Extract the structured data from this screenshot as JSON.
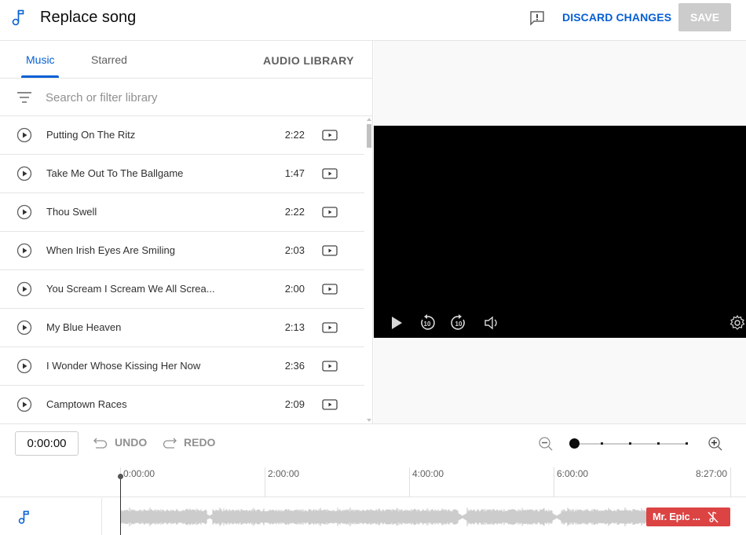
{
  "header": {
    "title": "Replace song",
    "discard_label": "DISCARD CHANGES",
    "save_label": "SAVE",
    "icons": {
      "app": "music-note-icon",
      "feedback": "feedback-icon"
    }
  },
  "library": {
    "tabs": [
      {
        "label": "Music",
        "active": true
      },
      {
        "label": "Starred",
        "active": false
      }
    ],
    "audio_library_label": "AUDIO LIBRARY",
    "search": {
      "placeholder": "Search or filter library",
      "value": ""
    },
    "tracks": [
      {
        "title": "Putting On The Ritz",
        "duration": "2:22"
      },
      {
        "title": "Take Me Out To The Ballgame",
        "duration": "1:47"
      },
      {
        "title": "Thou Swell",
        "duration": "2:22"
      },
      {
        "title": "When Irish Eyes Are Smiling",
        "duration": "2:03"
      },
      {
        "title": "You Scream I Scream We All Screa...",
        "duration": "2:00"
      },
      {
        "title": "My Blue Heaven",
        "duration": "2:13"
      },
      {
        "title": "I Wonder Whose Kissing Her Now",
        "duration": "2:36"
      },
      {
        "title": "Camptown Races",
        "duration": "2:09"
      }
    ]
  },
  "player": {
    "controls": [
      "play-icon",
      "rewind-10-icon",
      "forward-10-icon",
      "volume-icon",
      "settings-icon"
    ]
  },
  "editor": {
    "current_time": "0:00:00",
    "undo_label": "UNDO",
    "redo_label": "REDO",
    "zoom_level": 0,
    "zoom_steps": 5,
    "ruler": [
      "0:00:00",
      "2:00:00",
      "4:00:00",
      "6:00:00",
      "8:27:00"
    ],
    "clip_label": "Mr. Epic ...",
    "accent_color": "#065fd4",
    "clip_color": "#dc4343"
  }
}
